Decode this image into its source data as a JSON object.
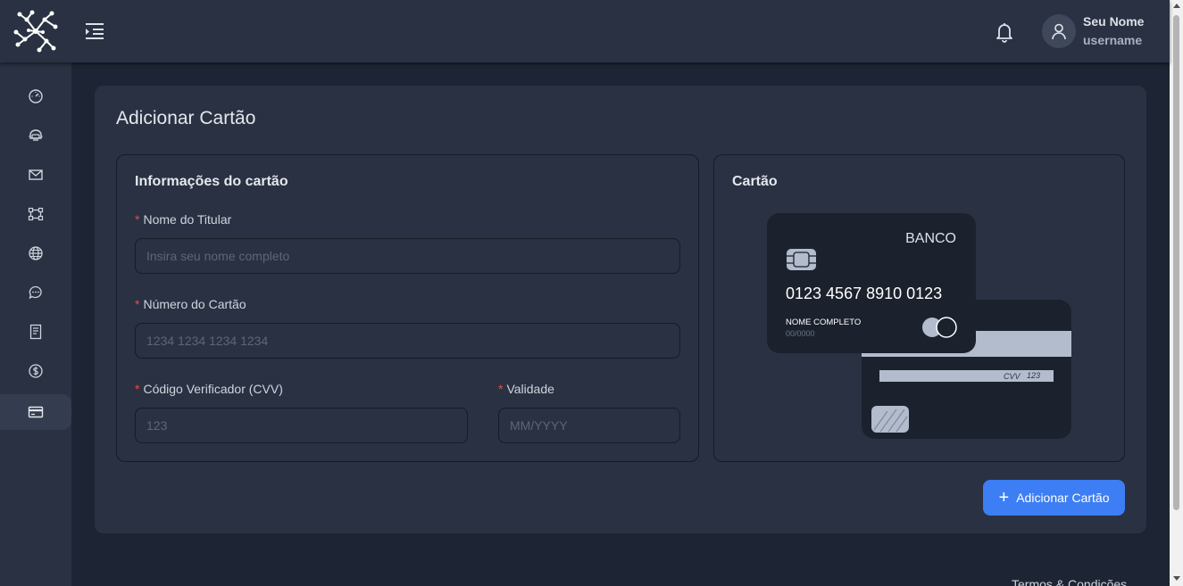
{
  "header": {
    "logo_icon": "network-logo-icon",
    "menu_icon": "menu-indent-icon",
    "notification_icon": "bell-icon",
    "avatar_icon": "user-icon",
    "user_name": "Seu Nome",
    "user_login": "username"
  },
  "sidebar": {
    "items": [
      {
        "icon": "dashboard-gauge-icon"
      },
      {
        "icon": "robot-icon"
      },
      {
        "icon": "mail-icon"
      },
      {
        "icon": "vector-shape-icon"
      },
      {
        "icon": "globe-icon"
      },
      {
        "icon": "chat-icon"
      },
      {
        "icon": "document-icon"
      },
      {
        "icon": "dollar-icon"
      },
      {
        "icon": "credit-card-icon",
        "active": true
      }
    ]
  },
  "main": {
    "title": "Adicionar Cartão",
    "info_panel": {
      "title": "Informações do cartão",
      "required_mark": "*",
      "name_label": "Nome do Titular",
      "name_placeholder": "Insira seu nome completo",
      "name_value": "",
      "number_label": "Número do Cartão",
      "number_placeholder": "1234 1234 1234 1234",
      "number_value": "",
      "cvv_label": "Código Verificador (CVV)",
      "cvv_placeholder": "123",
      "cvv_value": "",
      "expiry_label": "Validade",
      "expiry_placeholder": "MM/YYYY",
      "expiry_value": ""
    },
    "card_panel": {
      "title": "Cartão",
      "bank": "BANCO",
      "number": "0123 4567 8910 0123",
      "holder": "NOME COMPLETO",
      "expiry": "00/0000",
      "cvv_label": "CVV",
      "cvv_value": "123"
    },
    "add_button": {
      "icon": "plus-icon",
      "label": "Adicionar Cartão"
    }
  },
  "footer": {
    "terms_link": "Termos & Condições"
  },
  "colors": {
    "background": "#1d2433",
    "surface": "#2a3142",
    "accent": "#3d7ef4",
    "required": "#ec4a4a"
  }
}
